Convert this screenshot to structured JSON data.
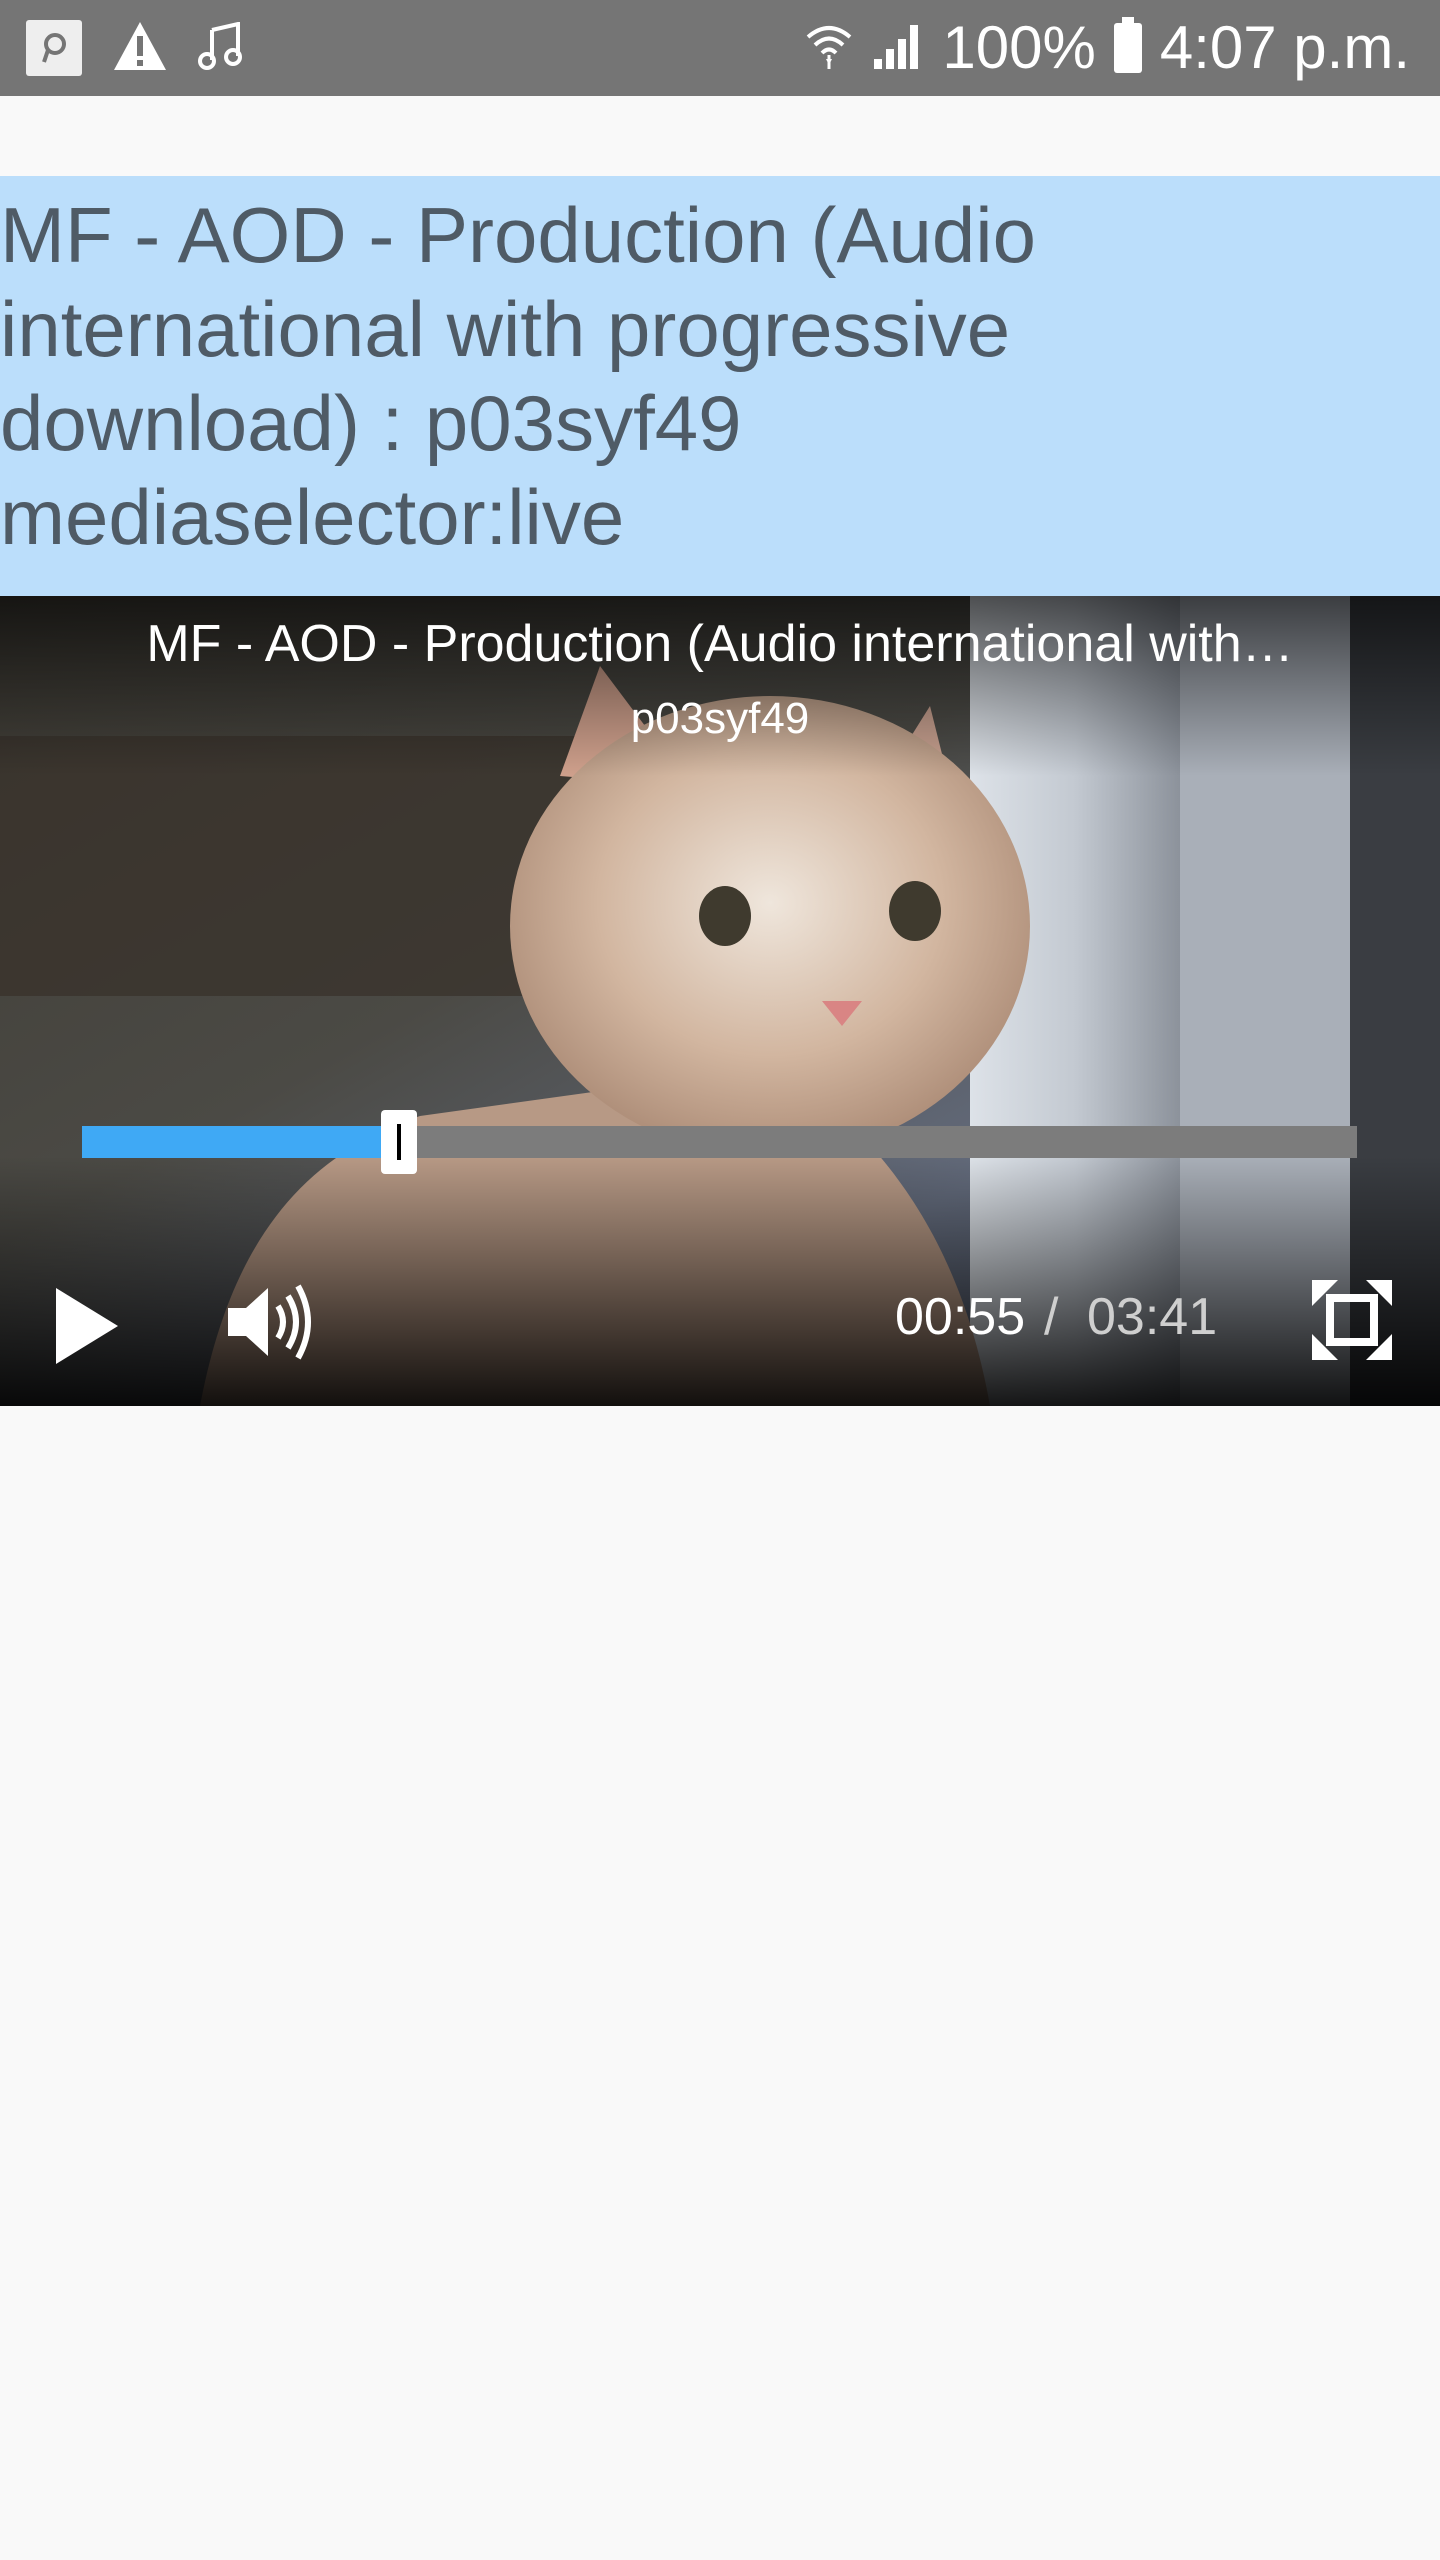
{
  "status_bar": {
    "battery": "100%",
    "time": "4:07 p.m.",
    "left_icons": [
      "p-icon",
      "warning-icon",
      "music-icon"
    ],
    "right_icons": [
      "wifi-icon",
      "signal-icon",
      "battery-icon"
    ]
  },
  "page": {
    "title": "MF - AOD - Production (Audio international with progressive download) : p03syf49 mediaselector:live"
  },
  "player": {
    "title": "MF - AOD - Production (Audio international with…",
    "subtitle": "p03syf49",
    "current_time": "00:55",
    "separator": "/",
    "total_time": "03:41",
    "progress_fraction": 0.249,
    "accent_color": "#3fa9f5",
    "controls": [
      "play-icon",
      "volume-icon",
      "fullscreen-icon"
    ]
  }
}
